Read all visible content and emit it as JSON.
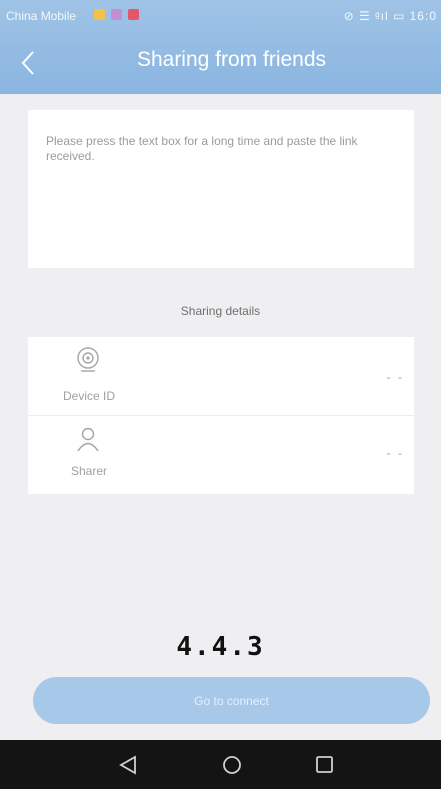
{
  "status_bar": {
    "carrier": "China Mobile",
    "right_text": "⊘ ☰ ᵍıl ▭ 16:0"
  },
  "header": {
    "back_icon": "chevron-left-icon",
    "title": "Sharing from friends"
  },
  "link_input": {
    "placeholder": "Please press the text box for a long time and paste the link received."
  },
  "sharing_details": {
    "section_title": "Sharing details",
    "rows": [
      {
        "icon": "camera-icon",
        "label": "Device ID",
        "value": "- -"
      },
      {
        "icon": "person-icon",
        "label": "Sharer",
        "value": "- -"
      }
    ]
  },
  "version_label": "4.4.3",
  "connect_button": {
    "label": "Go to connect"
  },
  "nav_bar": {
    "buttons": [
      "back-triangle-icon",
      "home-circle-icon",
      "recents-square-icon"
    ]
  },
  "colors": {
    "header": "#8ab5e0",
    "button": "#a8c8ea",
    "background": "#efeff1",
    "nav_bar": "#141414"
  }
}
